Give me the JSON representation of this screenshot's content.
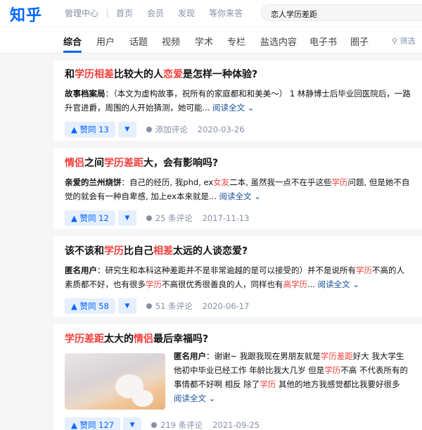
{
  "header": {
    "logo": "知乎",
    "nav": [
      "管理中心",
      "首页",
      "会员",
      "发现",
      "等你来答"
    ],
    "search_value": "恋人学历差距"
  },
  "tabs": [
    "综合",
    "用户",
    "话题",
    "视频",
    "学术",
    "专栏",
    "盐选内容",
    "电子书",
    "圈子"
  ],
  "filter_label": "筛选",
  "colors": {
    "brand": "#0066ff",
    "highlight": "#f1403c",
    "link": "#175199"
  },
  "results": [
    {
      "title": [
        [
          "和",
          false
        ],
        [
          "学历相差",
          true
        ],
        [
          "比较大的人",
          false
        ],
        [
          "恋爱",
          true
        ],
        [
          "是怎样一种体验?",
          false
        ]
      ],
      "author": "故事档案局",
      "excerpt": [
        [
          "：（本文为虚构故事，祝所有的家庭都和和美美～） 1 林静博士后毕业回医院后，一路升官进爵，周围的人开始猜测，她可能...",
          false
        ]
      ],
      "read_more": "阅读全文",
      "votes": "赞同 13",
      "comment": "添加评论",
      "date": "2020-03-26"
    },
    {
      "title": [
        [
          "情侣",
          true
        ],
        [
          "之间",
          false
        ],
        [
          "学历差距",
          true
        ],
        [
          "大，会有影响吗?",
          false
        ]
      ],
      "author": "亲爱的兰州烧饼",
      "excerpt": [
        [
          "：自己的经历, 我phd, ex",
          false
        ],
        [
          "女友",
          true
        ],
        [
          "二本, 虽然我一点不在乎这些",
          false
        ],
        [
          "学历",
          true
        ],
        [
          "问题, 但是她不自觉的就会有一种自卑感, 加上ex本来就是...",
          false
        ]
      ],
      "read_more": "阅读全文",
      "votes": "赞同 12",
      "comment": "25 条评论",
      "date": "2017-11-13"
    },
    {
      "title": [
        [
          "该不该和",
          false
        ],
        [
          "学历",
          true
        ],
        [
          "比自己",
          false
        ],
        [
          "相差",
          true
        ],
        [
          "太远的人谈恋爱?",
          false
        ]
      ],
      "author": "匿名用户",
      "excerpt": [
        [
          "：研究生和本科这种差距并不是非常逾越的是可以接受的）并不是说所有",
          false
        ],
        [
          "学历",
          true
        ],
        [
          "不高的人素质都不好，也有很多",
          false
        ],
        [
          "学历",
          true
        ],
        [
          "不高很优秀很善良的人，同样也有",
          false
        ],
        [
          "高学历",
          true
        ],
        [
          "...",
          false
        ]
      ],
      "read_more": "阅读全文",
      "votes": "赞同 58",
      "comment": "51 条评论",
      "date": "2020-06-17"
    },
    {
      "title": [
        [
          "学历差距",
          true
        ],
        [
          "太大的",
          false
        ],
        [
          "情侣",
          true
        ],
        [
          "最后幸福吗?",
          false
        ]
      ],
      "author": "匿名用户",
      "excerpt": [
        [
          "：谢谢~ 我跟我现在男朋友就是",
          false
        ],
        [
          "学历差距",
          true
        ],
        [
          "好大 我大学生 他初中毕业已经工作 年龄比我大几岁 但是",
          false
        ],
        [
          "学历",
          true
        ],
        [
          "不高 不代表所有的事情都不好啊 相反 除了",
          false
        ],
        [
          "学历",
          true
        ],
        [
          " 其他的地方我感觉都比我要好很多",
          false
        ]
      ],
      "read_more": "阅读全文",
      "votes": "赞同 127",
      "comment": "219 条评论",
      "date": "2021-09-25"
    }
  ]
}
